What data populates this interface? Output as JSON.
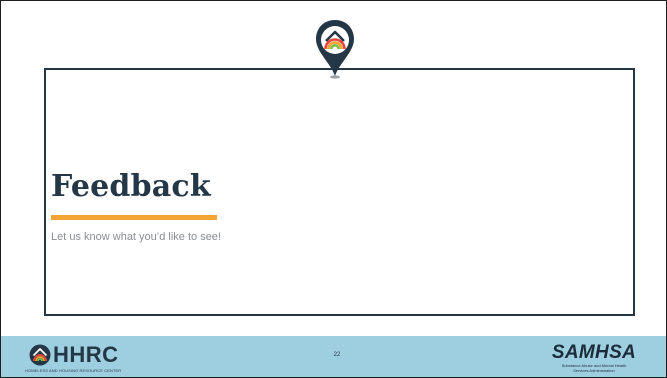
{
  "slide": {
    "title": "Feedback",
    "subtitle": "Let us know what you’d like to see!",
    "page_number": "22"
  },
  "footer": {
    "left_logo": {
      "text": "HHRC",
      "tagline": "HOMELESS AND HOUSING RESOURCE CENTER"
    },
    "right_logo": {
      "text": "SAMHSA",
      "tagline_line1": "Substance Abuse and Mental Health",
      "tagline_line2": "Services Administration"
    }
  },
  "colors": {
    "navy": "#243746",
    "accent_orange": "#f2a534",
    "footer_blue": "#9ecfe0",
    "subtitle_gray": "#8a8f94"
  },
  "icons": {
    "header_pin": "map-pin-house-icon",
    "hhrc_mark": "house-rainbow-icon"
  }
}
